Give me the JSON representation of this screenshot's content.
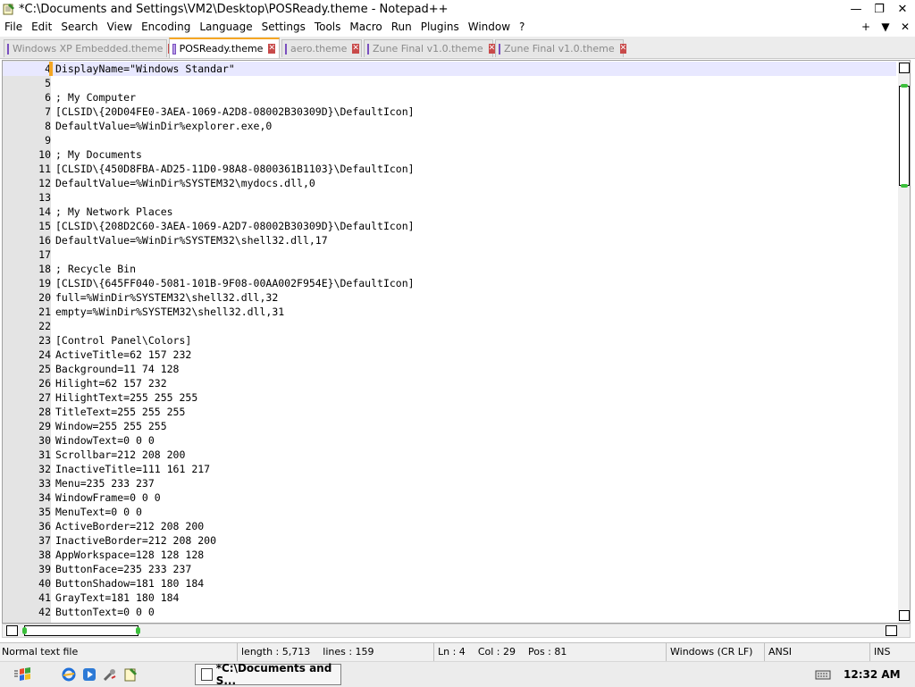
{
  "window": {
    "title": "*C:\\Documents and Settings\\VM2\\Desktop\\POSReady.theme - Notepad++",
    "minimize": "—",
    "restore": "❐",
    "close": "✕"
  },
  "menu": {
    "items": [
      "File",
      "Edit",
      "Search",
      "View",
      "Encoding",
      "Language",
      "Settings",
      "Tools",
      "Macro",
      "Run",
      "Plugins",
      "Window",
      "?"
    ],
    "right": [
      "+",
      "▼",
      "✕"
    ]
  },
  "tabs": [
    {
      "label": "Windows XP Embedded.theme",
      "active": false
    },
    {
      "label": "POSReady.theme",
      "active": true
    },
    {
      "label": "aero.theme",
      "active": false
    },
    {
      "label": "Zune Final v1.0.theme",
      "active": false
    },
    {
      "label": "Zune Final v1.0.theme",
      "active": false
    }
  ],
  "editor": {
    "current_line": 4,
    "lines": [
      {
        "n": "4",
        "text": "DisplayName=\"Windows Standar\""
      },
      {
        "n": "5",
        "text": ""
      },
      {
        "n": "6",
        "text": "; My Computer"
      },
      {
        "n": "7",
        "text": "[CLSID\\{20D04FE0-3AEA-1069-A2D8-08002B30309D}\\DefaultIcon]"
      },
      {
        "n": "8",
        "text": "DefaultValue=%WinDir%explorer.exe,0"
      },
      {
        "n": "9",
        "text": ""
      },
      {
        "n": "10",
        "text": "; My Documents"
      },
      {
        "n": "11",
        "text": "[CLSID\\{450D8FBA-AD25-11D0-98A8-0800361B1103}\\DefaultIcon]"
      },
      {
        "n": "12",
        "text": "DefaultValue=%WinDir%SYSTEM32\\mydocs.dll,0"
      },
      {
        "n": "13",
        "text": ""
      },
      {
        "n": "14",
        "text": "; My Network Places"
      },
      {
        "n": "15",
        "text": "[CLSID\\{208D2C60-3AEA-1069-A2D7-08002B30309D}\\DefaultIcon]"
      },
      {
        "n": "16",
        "text": "DefaultValue=%WinDir%SYSTEM32\\shell32.dll,17"
      },
      {
        "n": "17",
        "text": ""
      },
      {
        "n": "18",
        "text": "; Recycle Bin"
      },
      {
        "n": "19",
        "text": "[CLSID\\{645FF040-5081-101B-9F08-00AA002F954E}\\DefaultIcon]"
      },
      {
        "n": "20",
        "text": "full=%WinDir%SYSTEM32\\shell32.dll,32"
      },
      {
        "n": "21",
        "text": "empty=%WinDir%SYSTEM32\\shell32.dll,31"
      },
      {
        "n": "22",
        "text": ""
      },
      {
        "n": "23",
        "text": "[Control Panel\\Colors]"
      },
      {
        "n": "24",
        "text": "ActiveTitle=62 157 232"
      },
      {
        "n": "25",
        "text": "Background=11 74 128"
      },
      {
        "n": "26",
        "text": "Hilight=62 157 232"
      },
      {
        "n": "27",
        "text": "HilightText=255 255 255"
      },
      {
        "n": "28",
        "text": "TitleText=255 255 255"
      },
      {
        "n": "29",
        "text": "Window=255 255 255"
      },
      {
        "n": "30",
        "text": "WindowText=0 0 0"
      },
      {
        "n": "31",
        "text": "Scrollbar=212 208 200"
      },
      {
        "n": "32",
        "text": "InactiveTitle=111 161 217"
      },
      {
        "n": "33",
        "text": "Menu=235 233 237"
      },
      {
        "n": "34",
        "text": "WindowFrame=0 0 0"
      },
      {
        "n": "35",
        "text": "MenuText=0 0 0"
      },
      {
        "n": "36",
        "text": "ActiveBorder=212 208 200"
      },
      {
        "n": "37",
        "text": "InactiveBorder=212 208 200"
      },
      {
        "n": "38",
        "text": "AppWorkspace=128 128 128"
      },
      {
        "n": "39",
        "text": "ButtonFace=235 233 237"
      },
      {
        "n": "40",
        "text": "ButtonShadow=181 180 184"
      },
      {
        "n": "41",
        "text": "GrayText=181 180 184"
      },
      {
        "n": "42",
        "text": "ButtonText=0 0 0"
      }
    ]
  },
  "status": {
    "file_type": "Normal text file",
    "length": "length : 5,713",
    "lines": "lines : 159",
    "ln": "Ln : 4",
    "col": "Col : 29",
    "pos": "Pos : 81",
    "eol": "Windows (CR LF)",
    "encoding": "ANSI",
    "mode": "INS"
  },
  "taskbar": {
    "task_label": "*C:\\Documents and S...",
    "clock": "12:32 AM"
  },
  "colors": {
    "current_line_bg": "#e8e8ff",
    "gutter_bg": "#e4e4e4",
    "active_tab_accent": "#f5a623",
    "scroll_grip": "#3bbf3b"
  }
}
